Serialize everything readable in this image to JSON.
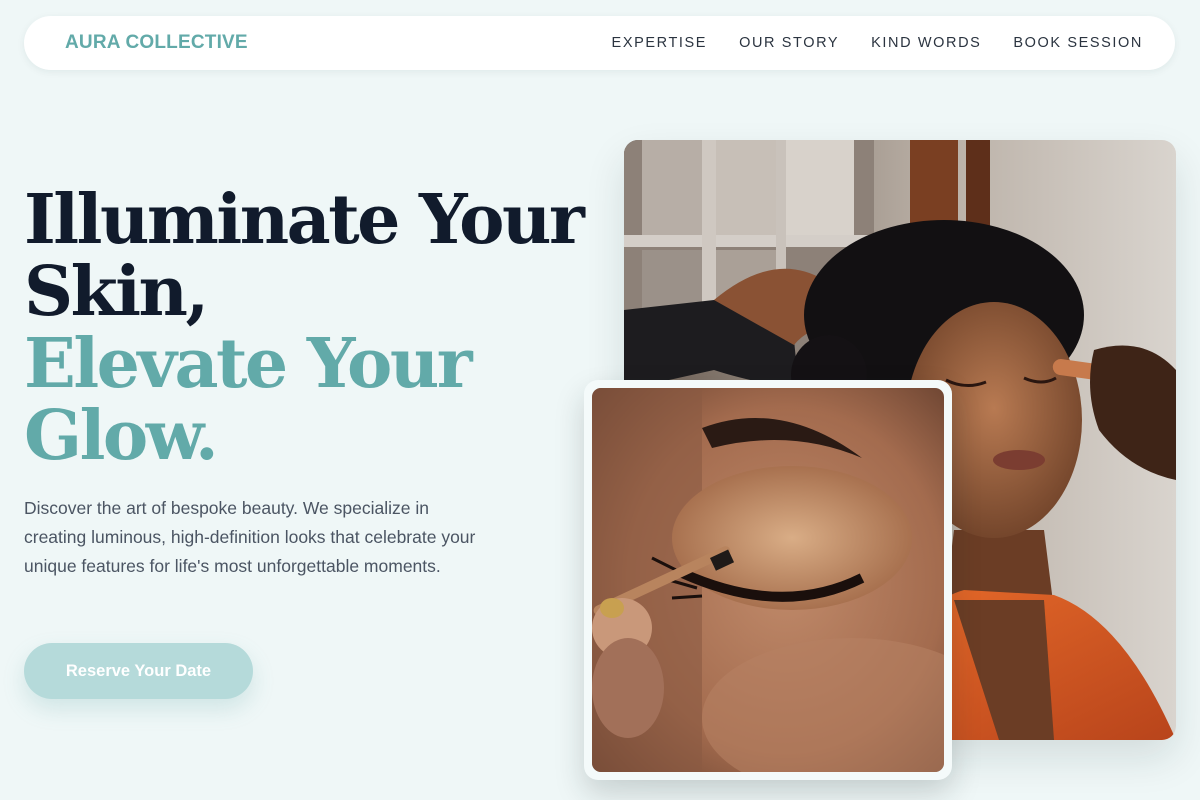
{
  "nav": {
    "brand": "AURA COLLECTIVE",
    "links": [
      "EXPERTISE",
      "OUR STORY",
      "KIND WORDS",
      "BOOK SESSION"
    ]
  },
  "hero": {
    "title_line1": "Illuminate Your",
    "title_line2": "Skin,",
    "title_line3": "Elevate Your",
    "title_line4": "Glow.",
    "description": "Discover the art of bespoke beauty. We specialize in creating luminous, high-definition looks that celebrate your unique features for life's most unforgettable moments.",
    "cta_label": "Reserve Your Date"
  },
  "colors": {
    "background": "#eff7f7",
    "accent": "#62aaa9",
    "heading_dark": "#111b2c",
    "cta_bg": "#b5dada"
  },
  "images": {
    "main": "woman-receiving-makeup-photo",
    "inset": "eye-makeup-closeup-photo"
  }
}
